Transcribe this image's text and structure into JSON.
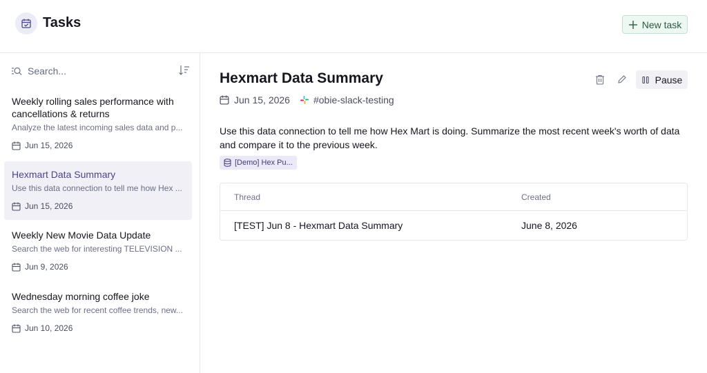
{
  "header": {
    "title": "Tasks",
    "app_icon": "calendar-check-icon",
    "new_task_label": "New task"
  },
  "sidebar": {
    "search_placeholder": "Search...",
    "items": [
      {
        "title": "Weekly rolling sales performance with cancellations & returns",
        "description": "Analyze the latest incoming sales data and p...",
        "date": "Jun 15, 2026",
        "selected": false
      },
      {
        "title": "Hexmart Data Summary",
        "description": "Use this data connection to tell me how Hex ...",
        "date": "Jun 15, 2026",
        "selected": true
      },
      {
        "title": "Weekly New Movie Data Update",
        "description": "Search the web for interesting TELEVISION ...",
        "date": "Jun 9, 2026",
        "selected": false
      },
      {
        "title": "Wednesday morning coffee joke",
        "description": "Search the web for recent coffee trends, new...",
        "date": "Jun 10, 2026",
        "selected": false
      }
    ]
  },
  "detail": {
    "title": "Hexmart Data Summary",
    "date": "Jun 15, 2026",
    "channel": "#obie-slack-testing",
    "pause_label": "Pause",
    "description": "Use this data connection to tell me how Hex Mart is doing. Summarize the most recent week's worth of data and compare it to the previous week.",
    "data_source": "[Demo] Hex Pu...",
    "table": {
      "headers": [
        "Thread",
        "Created"
      ],
      "rows": [
        {
          "thread": "[TEST] Jun 8 - Hexmart Data Summary",
          "created": "June 8, 2026"
        }
      ]
    }
  },
  "colors": {
    "accent_green": "#2b5a45",
    "selected_bg": "#f0f0f6",
    "selected_text": "#4b4589"
  }
}
